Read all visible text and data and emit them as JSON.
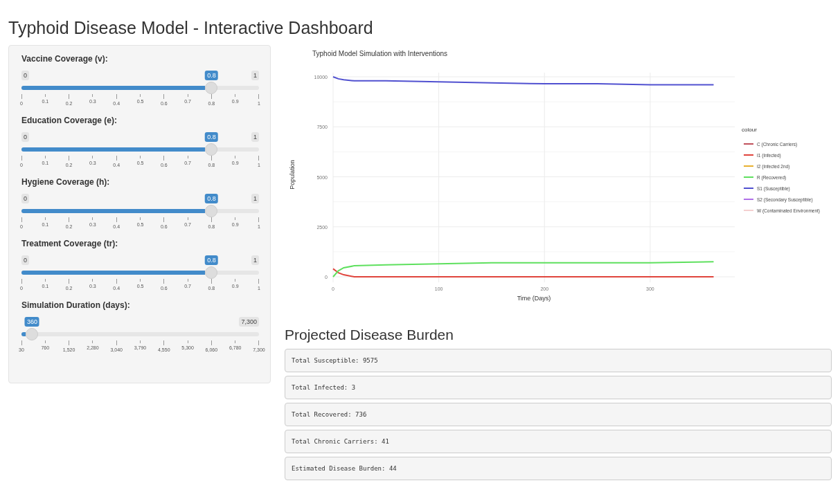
{
  "title": "Typhoid Disease Model - Interactive Dashboard",
  "sliders": [
    {
      "label": "Vaccine Coverage (v):",
      "min": "0",
      "max": "1",
      "value": "0.8",
      "level": 0.8,
      "ticks": [
        "0",
        "0.1",
        "0.2",
        "0.3",
        "0.4",
        "0.5",
        "0.6",
        "0.7",
        "0.8",
        "0.9",
        "1"
      ]
    },
    {
      "label": "Education Coverage (e):",
      "min": "0",
      "max": "1",
      "value": "0.8",
      "level": 0.8,
      "ticks": [
        "0",
        "0.1",
        "0.2",
        "0.3",
        "0.4",
        "0.5",
        "0.6",
        "0.7",
        "0.8",
        "0.9",
        "1"
      ]
    },
    {
      "label": "Hygiene Coverage (h):",
      "min": "0",
      "max": "1",
      "value": "0.8",
      "level": 0.8,
      "ticks": [
        "0",
        "0.1",
        "0.2",
        "0.3",
        "0.4",
        "0.5",
        "0.6",
        "0.7",
        "0.8",
        "0.9",
        "1"
      ]
    },
    {
      "label": "Treatment Coverage (tr):",
      "min": "0",
      "max": "1",
      "value": "0.8",
      "level": 0.8,
      "ticks": [
        "0",
        "0.1",
        "0.2",
        "0.3",
        "0.4",
        "0.5",
        "0.6",
        "0.7",
        "0.8",
        "0.9",
        "1"
      ]
    },
    {
      "label": "Simulation Duration (days):",
      "max": "7,300",
      "value": "360",
      "level": 0.045,
      "ticks": [
        "30",
        "760",
        "1,520",
        "2,280",
        "3,040",
        "3,790",
        "4,550",
        "5,300",
        "6,060",
        "6,780",
        "7,300"
      ]
    }
  ],
  "plot": {
    "chart_data": {
      "type": "line",
      "title": "Typhoid Model Simulation with Interventions",
      "xlabel": "Time (Days)",
      "ylabel": "Population",
      "grid": true,
      "x": [
        0,
        5,
        10,
        20,
        50,
        100,
        150,
        200,
        250,
        300,
        360
      ],
      "xlim": [
        0,
        380
      ],
      "ylim": [
        0,
        10000
      ],
      "xticks": [
        0,
        100,
        200,
        300
      ],
      "yticks": [
        0,
        2500,
        5000,
        7500,
        10000
      ],
      "series": [
        {
          "name": "I1 (Infected)",
          "color": "#e0443c",
          "values": [
            400,
            200,
            100,
            0,
            0,
            0,
            0,
            0,
            0,
            0,
            0
          ]
        },
        {
          "name": "R (Recovered)",
          "color": "#5ee05e",
          "values": [
            0,
            300,
            450,
            550,
            600,
            650,
            700,
            700,
            700,
            700,
            750
          ]
        },
        {
          "name": "S1 (Susceptible)",
          "color": "#5050d0",
          "values": [
            10000,
            9900,
            9850,
            9800,
            9800,
            9750,
            9700,
            9650,
            9650,
            9600,
            9600
          ]
        }
      ],
      "legend": {
        "title": "colour",
        "items": [
          {
            "kind": "key",
            "name": "C (Chronic Carriers)",
            "color": "#c0505a"
          },
          {
            "kind": "series"
          },
          {
            "kind": "key",
            "name": "I2 (Infected 2nd)",
            "color": "#e8b030"
          },
          {
            "kind": "series"
          },
          {
            "kind": "series"
          },
          {
            "kind": "key",
            "name": "S2 (Secondary Susceptible)",
            "color": "#b070e8"
          },
          {
            "kind": "key",
            "name": "W (Contaminated Environment)",
            "color": "#f4d0d0"
          }
        ]
      }
    }
  },
  "burden": {
    "heading": "Projected Disease Burden",
    "items": [
      "Total Susceptible: 9575",
      "Total Infected: 3",
      "Total Recovered: 736",
      "Total Chronic Carriers: 41",
      "Estimated Disease Burden: 44"
    ]
  }
}
